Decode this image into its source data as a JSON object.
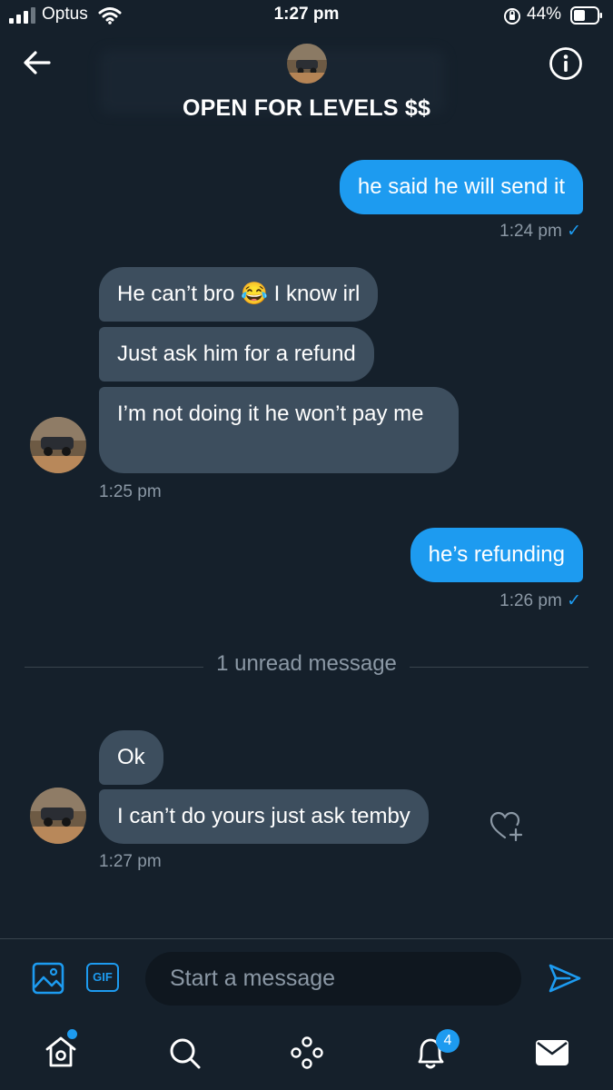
{
  "status_bar": {
    "carrier": "Optus",
    "time": "1:27 pm",
    "battery": "44%"
  },
  "header": {
    "title": "OPEN FOR LEVELS $$"
  },
  "messages": [
    {
      "direction": "out",
      "text": "he said he will send it",
      "time": "1:24 pm",
      "check": "✓"
    },
    {
      "direction": "in",
      "text": "He can’t bro 😂 I know irl"
    },
    {
      "direction": "in",
      "text": "Just ask him for a refund"
    },
    {
      "direction": "in",
      "text": "I’m not doing it he won’t pay me",
      "time": "1:25 pm"
    },
    {
      "direction": "out",
      "text": "he’s refunding",
      "time": "1:26 pm",
      "check": "✓"
    },
    {
      "direction": "in",
      "text": "Ok"
    },
    {
      "direction": "in",
      "text": "I can’t do yours just ask temby",
      "time": "1:27 pm"
    }
  ],
  "unread_divider": "1 unread message",
  "composer": {
    "placeholder": "Start a message",
    "gif_label": "GIF"
  },
  "bottom_nav": {
    "notifications_badge": "4"
  },
  "colors": {
    "background": "#15202b",
    "accent": "#1d9bf0",
    "incoming_bubble": "#3d4e5e",
    "muted_text": "#8b98a5"
  }
}
